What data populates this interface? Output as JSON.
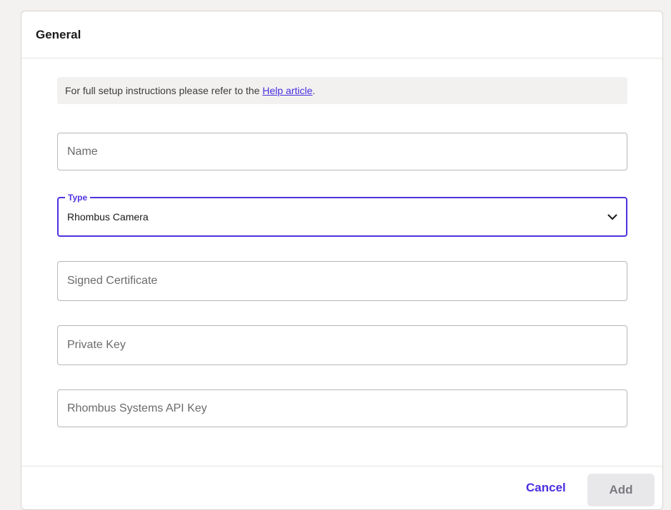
{
  "section": {
    "title": "General"
  },
  "banner": {
    "prefix": "For full setup instructions please refer to the ",
    "link_text": "Help article",
    "suffix": "."
  },
  "fields": {
    "name": {
      "placeholder": "Name",
      "value": ""
    },
    "type": {
      "label": "Type",
      "value": "Rhombus Camera",
      "icon": "chevron-down-icon"
    },
    "signed_certificate": {
      "placeholder": "Signed Certificate",
      "value": ""
    },
    "private_key": {
      "placeholder": "Private Key",
      "value": ""
    },
    "api_key": {
      "placeholder": "Rhombus Systems API Key",
      "value": ""
    }
  },
  "footer": {
    "cancel_label": "Cancel",
    "add_label": "Add"
  },
  "colors": {
    "accent": "#5232e0",
    "link": "#4b2ee0",
    "disabled_button_bg": "#e8e8ea",
    "page_bg": "#f3f2f1"
  }
}
